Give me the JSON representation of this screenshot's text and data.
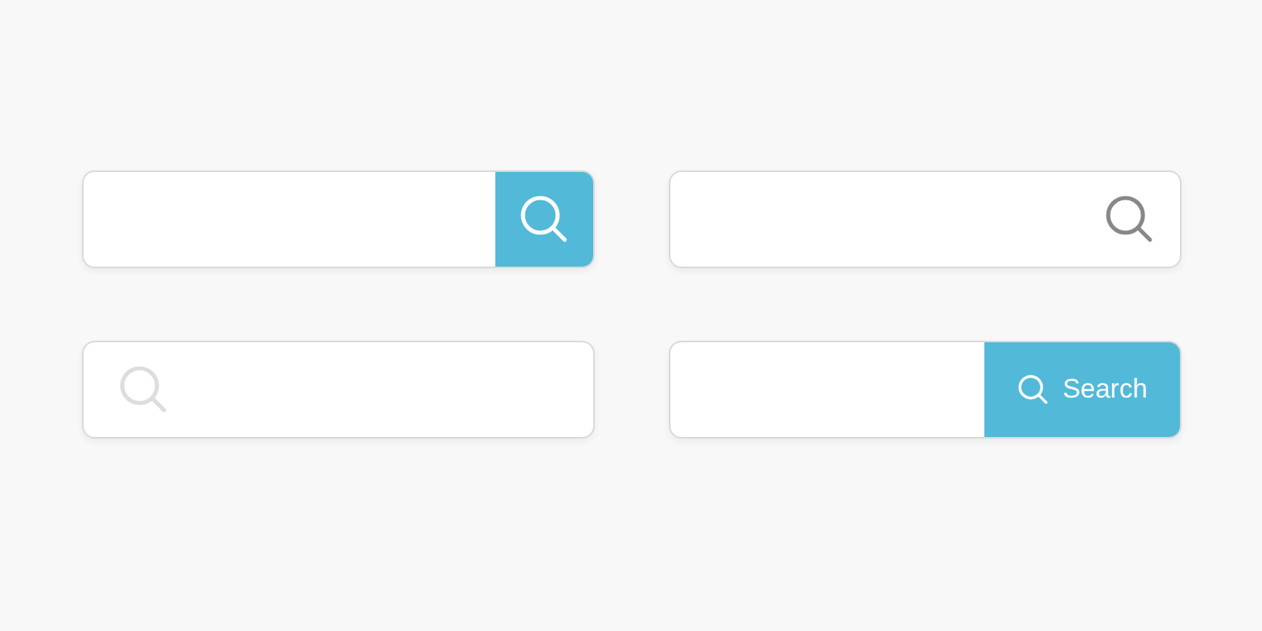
{
  "search_bars": [
    {
      "kind": "icon-button"
    },
    {
      "kind": "trailing-icon"
    },
    {
      "kind": "leading-icon"
    },
    {
      "kind": "text-button",
      "button_label": "Search"
    }
  ]
}
